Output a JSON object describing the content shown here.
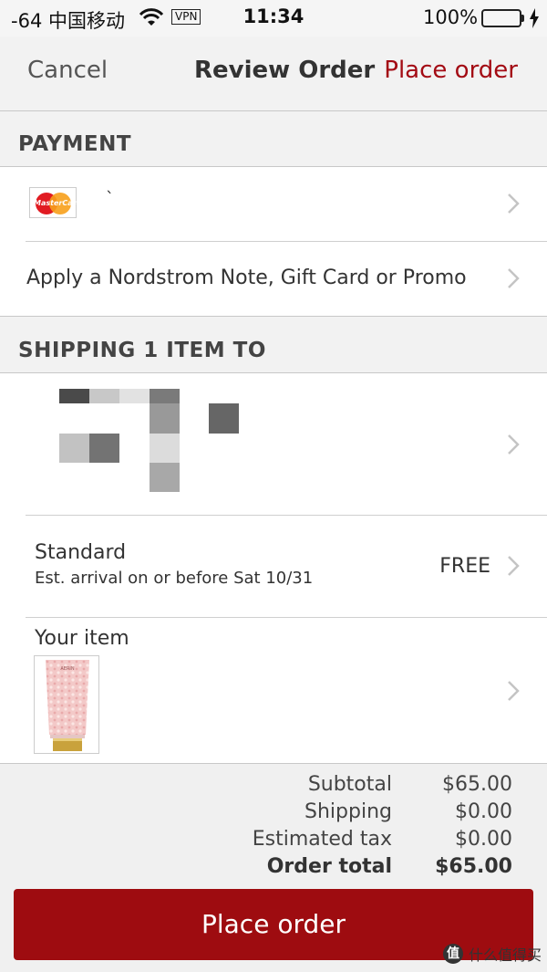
{
  "status_bar": {
    "carrier": "-64 中国移动",
    "vpn": "VPN",
    "time": "11:34",
    "battery_percent": "100%",
    "battery_level": 1.0,
    "battery_color": "#4cd964"
  },
  "nav": {
    "cancel": "Cancel",
    "title": "Review Order",
    "place_order": "Place order"
  },
  "payment": {
    "header": "PAYMENT",
    "card_brand": "MasterCard",
    "card_icon": "mastercard-icon",
    "card_number": "`",
    "promo_label": "Apply a Nordstrom Note, Gift Card or Promo"
  },
  "shipping": {
    "header": "SHIPPING 1 ITEM TO",
    "method_name": "Standard",
    "method_eta": "Est. arrival on or before Sat 10/31",
    "method_price": "FREE",
    "item_label": "Your item",
    "item_brand": "AERIN"
  },
  "totals": {
    "subtotal_label": "Subtotal",
    "subtotal_value": "$65.00",
    "shipping_label": "Shipping",
    "shipping_value": "$0.00",
    "tax_label": "Estimated tax",
    "tax_value": "$0.00",
    "order_total_label": "Order total",
    "order_total_value": "$65.00"
  },
  "place_order_button": "Place order",
  "watermark": {
    "logo_char": "值",
    "text": "什么值得买"
  },
  "colors": {
    "brand_red": "#9e0c10",
    "nav_red": "#a30b14"
  }
}
